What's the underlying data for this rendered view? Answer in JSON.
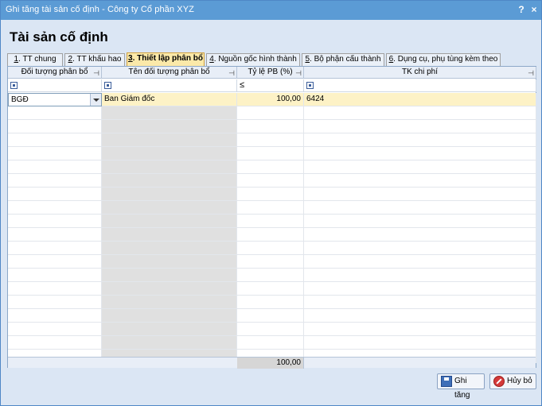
{
  "window": {
    "title": "Ghi tăng tài sản cố định - Công ty Cổ phần XYZ",
    "help_label": "?",
    "close_label": "×"
  },
  "page": {
    "heading": "Tài sản cố định"
  },
  "tabs": [
    {
      "num": "1",
      "label": ". TT chung"
    },
    {
      "num": "2",
      "label": ". TT khấu hao"
    },
    {
      "num": "3",
      "label": ". Thiết lập phân bổ"
    },
    {
      "num": "4",
      "label": ". Nguồn gốc hình thành"
    },
    {
      "num": "5",
      "label": ". Bộ phận cấu thành"
    },
    {
      "num": "6",
      "label": ". Dụng cụ, phụ tùng kèm theo"
    }
  ],
  "grid": {
    "columns": [
      "Đối tượng phân bổ",
      "Tên đối tượng phân bổ",
      "Tỷ lệ PB (%)",
      "TK chi phí"
    ],
    "filter_le_symbol": "≤",
    "rows": [
      {
        "doi_tuong": "BGĐ",
        "ten": "Ban Giám đốc",
        "ty_le": "100,00",
        "tk": "6424"
      }
    ],
    "total_ty_le": "100,00"
  },
  "buttons": {
    "save": "Ghi tăng",
    "save_hotkey": "G",
    "cancel": "Hủy bỏ"
  },
  "colors": {
    "titlebar": "#5b9bd5",
    "active_tab": "#fbe9a9",
    "selected_row": "#fdf2c6"
  }
}
